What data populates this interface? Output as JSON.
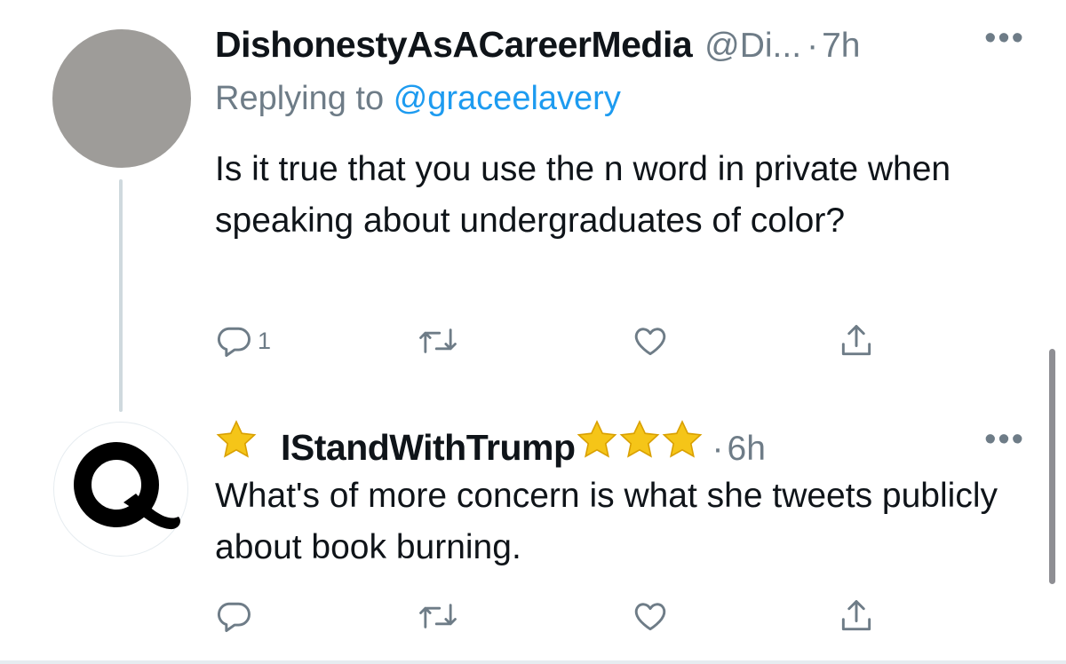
{
  "tweet1": {
    "display_name": "DishonestyAsACareerMedia",
    "handle": "@Di...",
    "time_sep": "·",
    "time": "7h",
    "more_icon": "ellipsis-icon",
    "replying_label": "Replying to",
    "replying_handle": "@graceelavery",
    "text": "Is it true that you use the n word in private when speaking about undergraduates of color?",
    "reply_count": "1",
    "retweet_count": "",
    "like_count": ""
  },
  "tweet2": {
    "display_name": "IStandWithTrump",
    "prefix_icon": "star-emoji",
    "suffix_icons": [
      "star-emoji",
      "star-emoji",
      "star-emoji"
    ],
    "time_sep": "·",
    "time": "6h",
    "more_icon": "ellipsis-icon",
    "text": "What's of more concern is what she tweets publicly about book burning.",
    "reply_count": "",
    "retweet_count": "",
    "like_count": ""
  },
  "colors": {
    "text": "#0f1419",
    "secondary": "#6e7c87",
    "link": "#1d9bf0",
    "thread_line": "#cfd9de",
    "star": "#f5c518"
  },
  "icons": [
    "reply-icon",
    "retweet-icon",
    "like-icon",
    "share-icon"
  ]
}
